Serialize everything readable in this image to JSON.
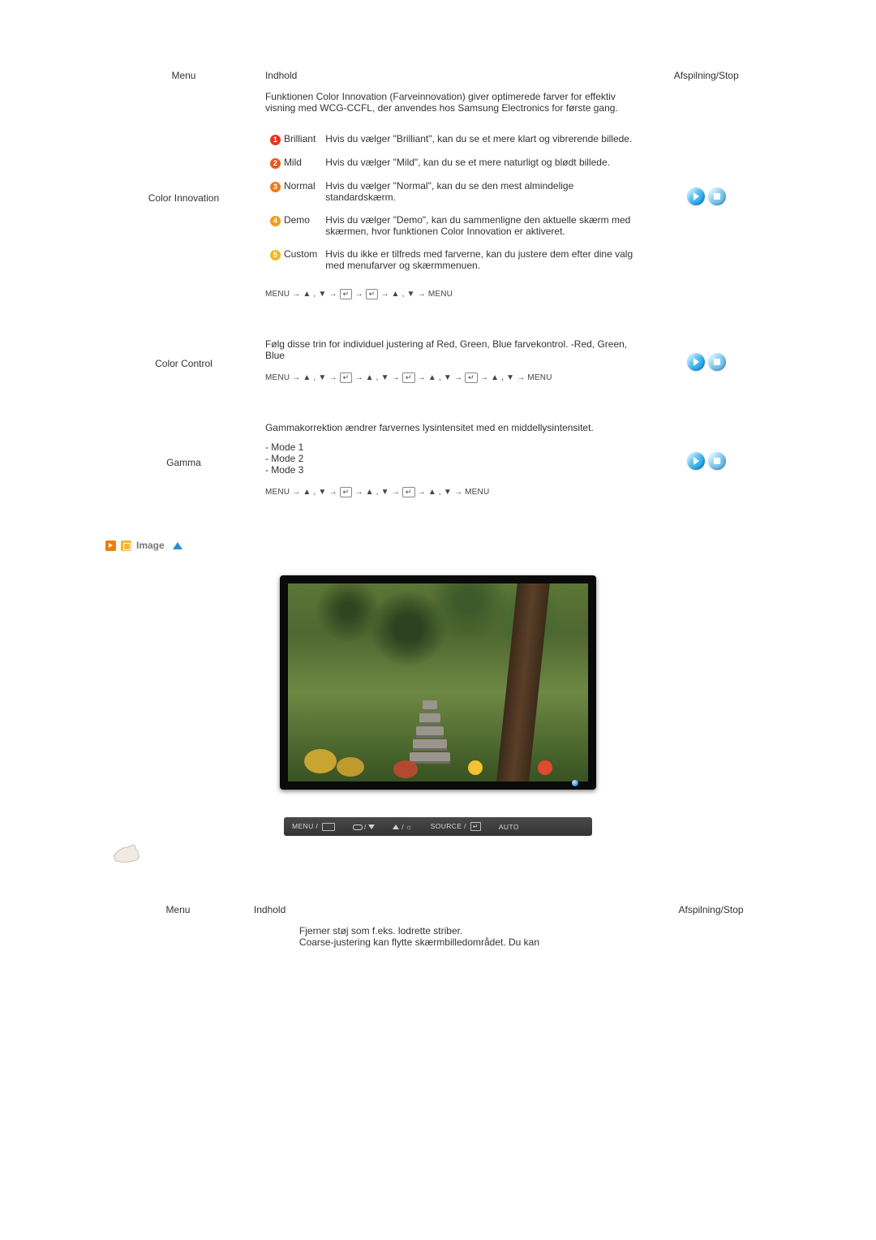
{
  "headers": {
    "menu": "Menu",
    "content": "Indhold",
    "play": "Afspilning/Stop"
  },
  "rows": {
    "colorInnovation": {
      "label": "Color Innovation",
      "intro": "Funktionen Color Innovation (Farveinnovation) giver optimerede farver for effektiv visning med WCG-CCFL, der anvendes hos Samsung Electronics for første gang.",
      "options": [
        {
          "name": "Brilliant",
          "desc": "Hvis du vælger \"Brilliant\", kan du se et mere klart og vibrerende billede."
        },
        {
          "name": "Mild",
          "desc": "Hvis du vælger \"Mild\", kan du se et mere naturligt og blødt billede."
        },
        {
          "name": "Normal",
          "desc": "Hvis du vælger \"Normal\", kan du se den mest almindelige standardskærm."
        },
        {
          "name": "Demo",
          "desc": "Hvis du vælger \"Demo\", kan du sammenligne den aktuelle skærm med skærmen, hvor funktionen Color Innovation er aktiveret."
        },
        {
          "name": "Custom",
          "desc": "Hvis du ikke er tilfreds med farverne, kan du justere dem efter dine valg med menufarver og skærmmenuen."
        }
      ]
    },
    "colorControl": {
      "label": "Color Control",
      "text": "Følg disse trin for individuel justering af Red, Green, Blue farvekontrol. -Red, Green, Blue"
    },
    "gamma": {
      "label": "Gamma",
      "text": "Gammakorrektion ændrer farvernes lysintensitet med en middellysintensitet.",
      "modes": [
        "- Mode 1",
        "- Mode 2",
        "- Mode 3"
      ]
    },
    "coarse": {
      "line1": "Fjerner støj som f.eks. lodrette striber.",
      "line2": "Coarse-justering kan flytte skærmbilledområdet. Du kan"
    }
  },
  "nav": {
    "menuWord": "MENU",
    "arrow": "→",
    "updown": "▲ , ▼",
    "enter": "↵"
  },
  "section": {
    "image_title": "Image"
  },
  "button_bar": {
    "menu": "MENU /",
    "source": "SOURCE /",
    "auto": "AUTO"
  }
}
